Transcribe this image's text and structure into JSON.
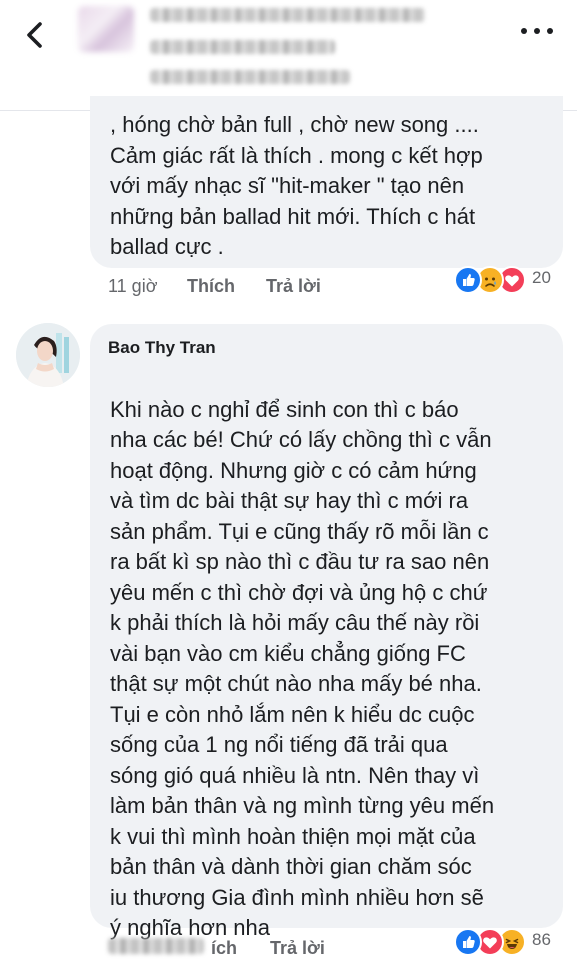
{
  "comment1": {
    "text": ", hóng chờ bản full , chờ new song ....\nCảm giác rất là thích . mong c kết hợp\nvới mấy nhạc sĩ \"hit-maker \" tạo nên\nnhững bản ballad hit mới. Thích c hát\nballad cực .",
    "time": "11 giờ",
    "like_label": "Thích",
    "reply_label": "Trả lời",
    "reactions": [
      "like-icon",
      "sad-icon",
      "love-icon"
    ],
    "reaction_count": "20"
  },
  "comment2": {
    "author": "Bao Thy Tran",
    "text": "Khi nào c nghỉ để sinh con thì c báo\nnha các bé! Chứ có lấy chồng thì c vẫn\nhoạt động. Nhưng giờ c có cảm hứng\nvà tìm dc bài thật sự hay thì c mới ra\nsản phẩm. Tụi e cũng thấy rõ mỗi lần c\nra bất kì sp nào thì c đầu tư ra sao nên\nyêu mến c thì chờ đợi và ủng hộ c chứ\nk phải thích là hỏi mấy câu thế này rồi\nvài bạn vào cm kiểu chẳng giống FC\nthật sự một chút nào nha mấy bé nha.\nTụi e còn nhỏ lắm nên k hiểu dc cuộc\nsống của 1 ng nổi tiếng đã trải qua\nsóng gió quá nhiều là ntn. Nên thay vì\nlàm bản thân và ng mình từng yêu mến\nk vui thì mình hoàn thiện mọi mặt của\nbản thân và dành thời gian chăm sóc\niu thương Gia đình mình nhiều hơn sẽ\ný nghĩa hơn nha",
    "emoji": "smile-emoji",
    "like_label_partial": "ích",
    "reply_label": "Trả lời",
    "reactions": [
      "like-icon",
      "love-icon",
      "haha-icon"
    ],
    "reaction_count": "86"
  },
  "colors": {
    "like": "#1877f2",
    "love": "#f33e58",
    "haha": "#f7b125",
    "bubble": "#f0f2f5",
    "meta": "#65676b"
  }
}
